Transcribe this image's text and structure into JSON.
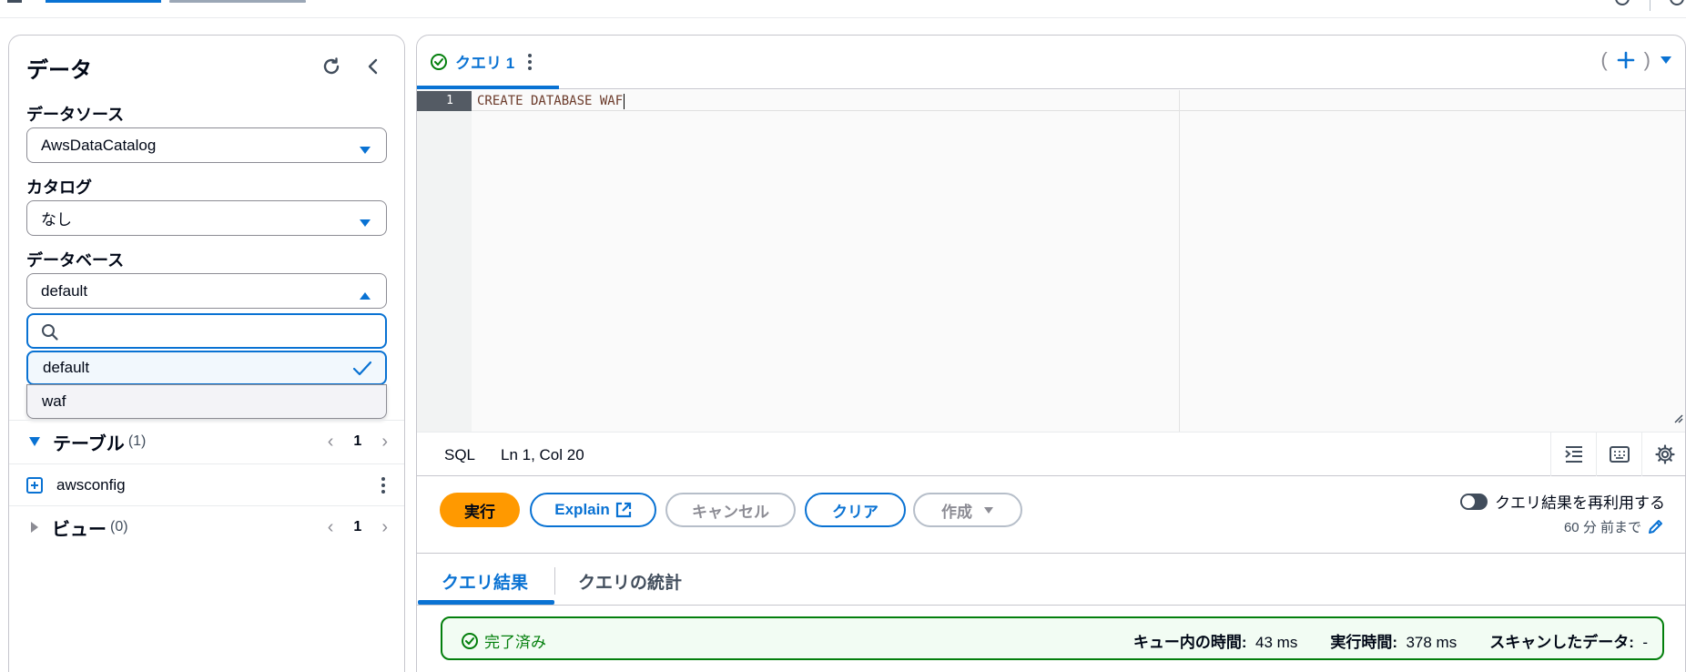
{
  "left_panel": {
    "title": "データ",
    "data_source_label": "データソース",
    "data_source_value": "AwsDataCatalog",
    "catalog_label": "カタログ",
    "catalog_value": "なし",
    "database_label": "データベース",
    "database_value": "default",
    "database_search_placeholder": "",
    "database_options": [
      "default",
      "waf"
    ],
    "tables_title": "テーブル",
    "tables_count": "(1)",
    "tables_page": "1",
    "table_item": "awsconfig",
    "views_title": "ビュー",
    "views_count": "(0)",
    "views_page": "1"
  },
  "query_tab": {
    "label": "クエリ 1"
  },
  "editor": {
    "line_number": "1",
    "code": "CREATE DATABASE WAF"
  },
  "status_bar": {
    "language": "SQL",
    "position": "Ln 1, Col 20"
  },
  "actions": {
    "run": "実行",
    "explain": "Explain",
    "cancel": "キャンセル",
    "clear": "クリア",
    "create": "作成",
    "reuse_label": "クエリ結果を再利用する",
    "reuse_sub": "60 分 前まで"
  },
  "result_tabs": {
    "results": "クエリ結果",
    "stats": "クエリの統計"
  },
  "result_status": {
    "status": "完了済み",
    "queue_label": "キュー内の時間:",
    "queue_value": "43 ms",
    "exec_label": "実行時間:",
    "exec_value": "378 ms",
    "scanned_label": "スキャンしたデータ:",
    "scanned_value": "-"
  },
  "colors": {
    "accent": "#0972d3",
    "run_button": "#ff9900",
    "success": "#037f0c"
  }
}
